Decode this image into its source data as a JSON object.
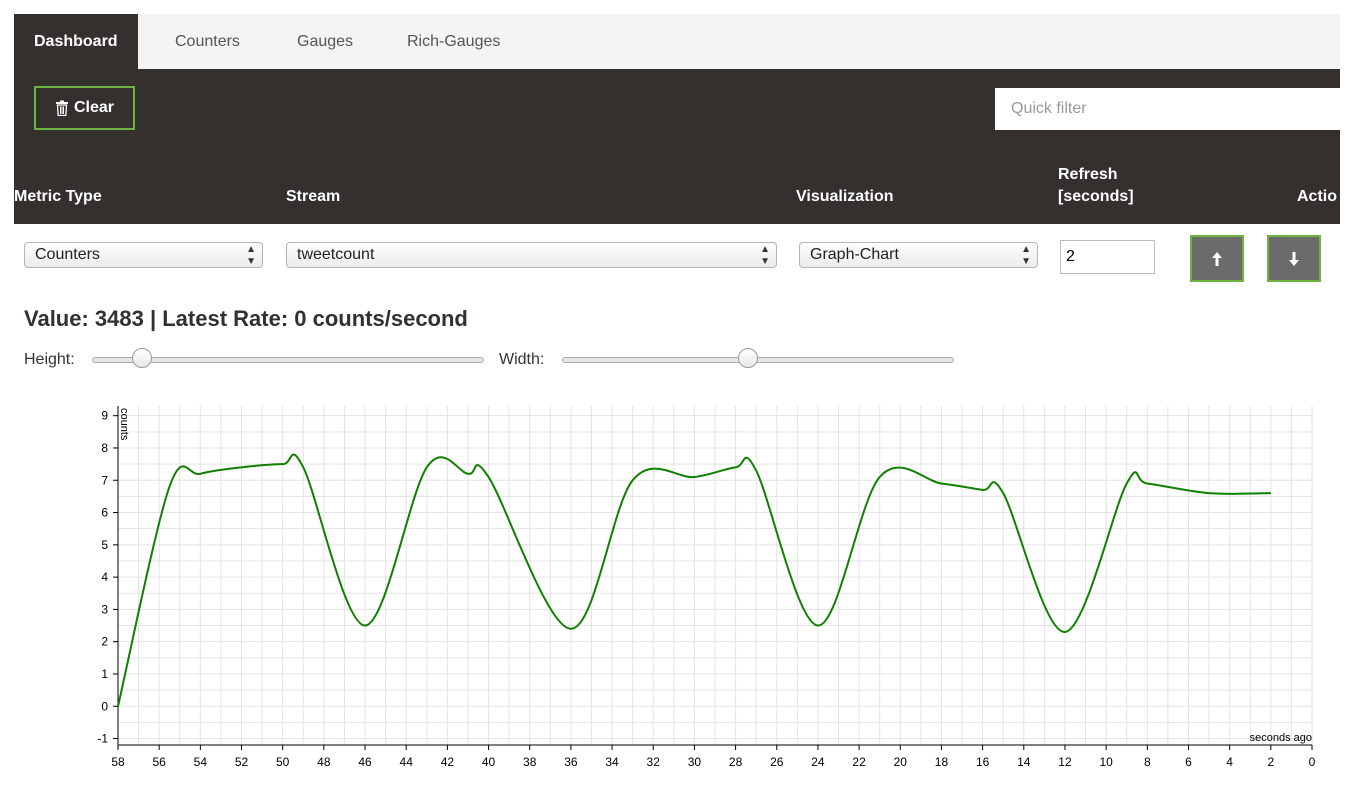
{
  "tabs": [
    {
      "label": "Dashboard",
      "active": true
    },
    {
      "label": "Counters",
      "active": false
    },
    {
      "label": "Gauges",
      "active": false
    },
    {
      "label": "Rich-Gauges",
      "active": false
    }
  ],
  "toolbar": {
    "clear_icon": "trash-icon",
    "clear_label": "Clear",
    "quick_filter_placeholder": "Quick filter"
  },
  "table_header": {
    "metric_type": "Metric Type",
    "stream": "Stream",
    "visualization": "Visualization",
    "refresh_line1": "Refresh",
    "refresh_line2": "[seconds]",
    "actions": "Actio"
  },
  "row": {
    "metric_type_value": "Counters",
    "stream_value": "tweetcount",
    "visualization_value": "Graph-Chart",
    "refresh_value": "2",
    "move_up_icon": "arrow-up-icon",
    "move_down_icon": "arrow-down-icon"
  },
  "value_line": "Value: 3483 | Latest Rate: 0 counts/second",
  "sliders": {
    "height_label": "Height:",
    "width_label": "Width:",
    "height_level": 0.12,
    "width_level": 0.47
  },
  "colors": {
    "dark": "#34302d",
    "accent": "#6db33f",
    "line": "#108000"
  },
  "chart_data": {
    "type": "line",
    "ylabel": "counts",
    "xlabel": "seconds ago",
    "xlim": [
      58,
      0
    ],
    "ylim": [
      -1.2,
      9.3
    ],
    "x_ticks": [
      "58",
      "56",
      "54",
      "52",
      "50",
      "48",
      "46",
      "44",
      "42",
      "40",
      "38",
      "36",
      "34",
      "32",
      "30",
      "28",
      "26",
      "24",
      "22",
      "20",
      "18",
      "16",
      "14",
      "12",
      "10",
      "8",
      "6",
      "4",
      "2",
      "0"
    ],
    "y_ticks": [
      "-1",
      "0",
      "1",
      "2",
      "3",
      "4",
      "5",
      "6",
      "7",
      "8",
      "9"
    ],
    "grid": true,
    "series": [
      {
        "x": [
          58,
          55.5,
          54,
          52,
          50,
          49,
          46,
          43,
          41,
          40,
          36,
          33,
          30,
          28,
          27,
          24,
          21,
          18,
          16,
          15,
          12,
          9,
          8,
          5,
          2
        ],
        "y": [
          0,
          6.8,
          7.2,
          7.4,
          7.5,
          7.4,
          2.5,
          7.4,
          7.2,
          7.1,
          2.4,
          7.0,
          7.1,
          7.4,
          7.3,
          2.5,
          7.1,
          6.9,
          6.7,
          6.6,
          2.3,
          6.9,
          6.9,
          6.6,
          6.6
        ]
      }
    ]
  }
}
